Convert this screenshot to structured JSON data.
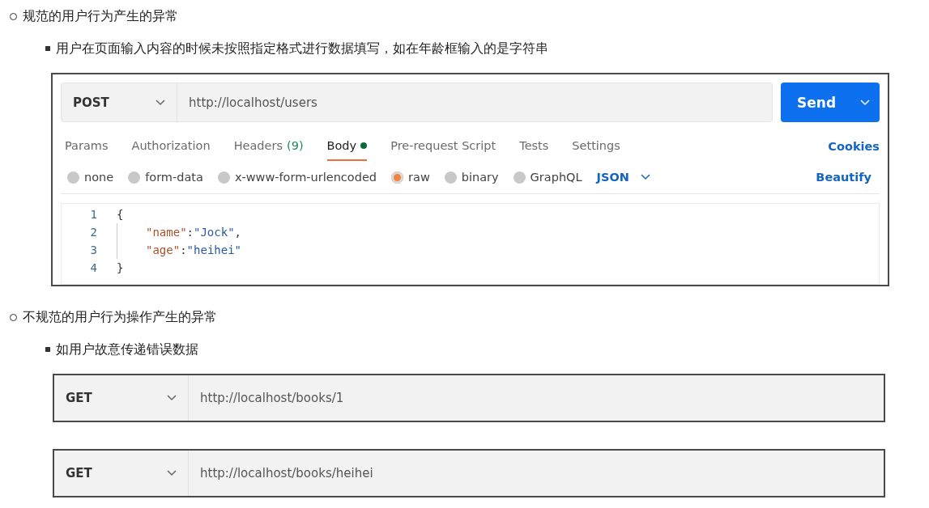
{
  "sections": [
    {
      "title": "规范的用户行为产生的异常",
      "item": "用户在页面输入内容的时候未按照指定格式进行数据填写，如在年龄框输入的是字符串",
      "screenshots": [
        {
          "kind": "request",
          "method": "POST",
          "url": "http://localhost/users",
          "send": "Send",
          "tabs": [
            {
              "label": "Params",
              "selected": false,
              "dot": false
            },
            {
              "label": "Authorization",
              "selected": false,
              "dot": false
            },
            {
              "label": "Headers",
              "count": "(9)",
              "selected": false,
              "dot": false
            },
            {
              "label": "Body",
              "selected": true,
              "dot": true
            },
            {
              "label": "Pre-request Script",
              "selected": false,
              "dot": false
            },
            {
              "label": "Tests",
              "selected": false,
              "dot": false
            },
            {
              "label": "Settings",
              "selected": false,
              "dot": false
            }
          ],
          "cookies": "Cookies",
          "body_types": [
            {
              "label": "none",
              "selected": false
            },
            {
              "label": "form-data",
              "selected": false
            },
            {
              "label": "x-www-form-urlencoded",
              "selected": false
            },
            {
              "label": "raw",
              "selected": true
            },
            {
              "label": "binary",
              "selected": false
            },
            {
              "label": "GraphQL",
              "selected": false
            }
          ],
          "format": "JSON",
          "beautify": "Beautify",
          "code_lines": [
            {
              "number": "1",
              "indent": false,
              "tokens": [
                {
                  "kind": "punct",
                  "text": "{"
                }
              ]
            },
            {
              "number": "2",
              "indent": true,
              "tokens": [
                {
                  "kind": "key",
                  "text": "\"name\""
                },
                {
                  "kind": "punct",
                  "text": ":"
                },
                {
                  "kind": "string",
                  "text": "\"Jock\""
                },
                {
                  "kind": "punct",
                  "text": ","
                }
              ]
            },
            {
              "number": "3",
              "indent": true,
              "tokens": [
                {
                  "kind": "key",
                  "text": "\"age\""
                },
                {
                  "kind": "punct",
                  "text": ":"
                },
                {
                  "kind": "string",
                  "text": "\"heihei\""
                }
              ]
            },
            {
              "number": "4",
              "indent": false,
              "tokens": [
                {
                  "kind": "punct",
                  "text": "}"
                }
              ]
            }
          ]
        }
      ]
    },
    {
      "title": "不规范的用户行为操作产生的异常",
      "item": "如用户故意传递错误数据",
      "screenshots": [
        {
          "kind": "url_bar",
          "method": "GET",
          "url": "http://localhost/books/1"
        },
        {
          "kind": "url_bar",
          "method": "GET",
          "url": "http://localhost/books/heihei"
        }
      ]
    }
  ]
}
